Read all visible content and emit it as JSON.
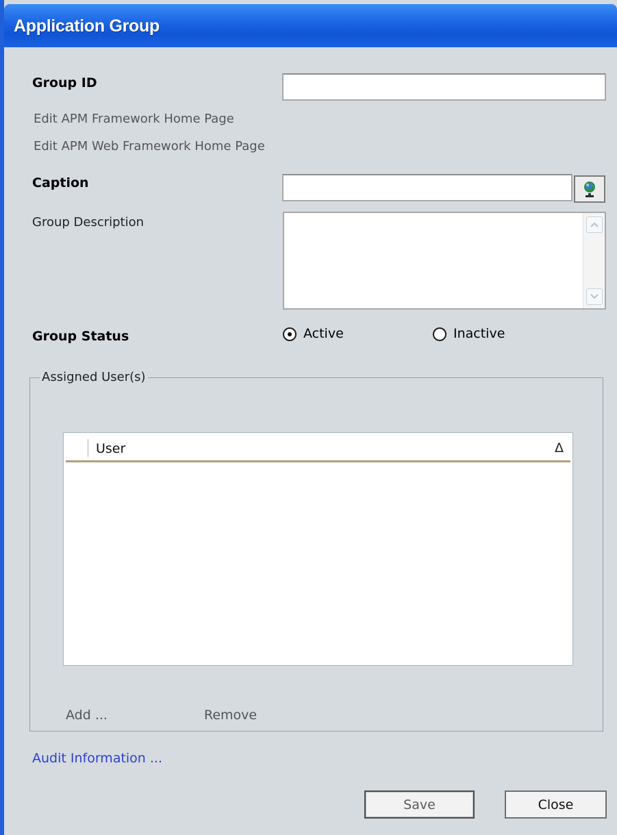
{
  "window": {
    "title": "Application Group"
  },
  "form": {
    "group_id_label": "Group ID",
    "group_id_value": "",
    "edit_home_link": "Edit APM Framework Home Page",
    "edit_web_home_link": "Edit APM Web Framework Home Page",
    "caption_label": "Caption",
    "caption_value": "",
    "description_label": "Group Description",
    "description_value": "",
    "status_label": "Group Status",
    "status_options": [
      {
        "label": "Active",
        "selected": true
      },
      {
        "label": "Inactive",
        "selected": false
      }
    ]
  },
  "assigned_users": {
    "legend": "Assigned User(s)",
    "grid": {
      "columns": [
        "User"
      ],
      "sort_indicator": "Δ",
      "rows": []
    },
    "add_label": "Add ...",
    "remove_label": "Remove"
  },
  "footer": {
    "audit_link": "Audit Information ...",
    "save_label": "Save",
    "close_label": "Close"
  },
  "colors": {
    "titlebar": "#1e66e6",
    "dialog_bg": "#d6dbe0",
    "link": "#2b3fd6"
  }
}
